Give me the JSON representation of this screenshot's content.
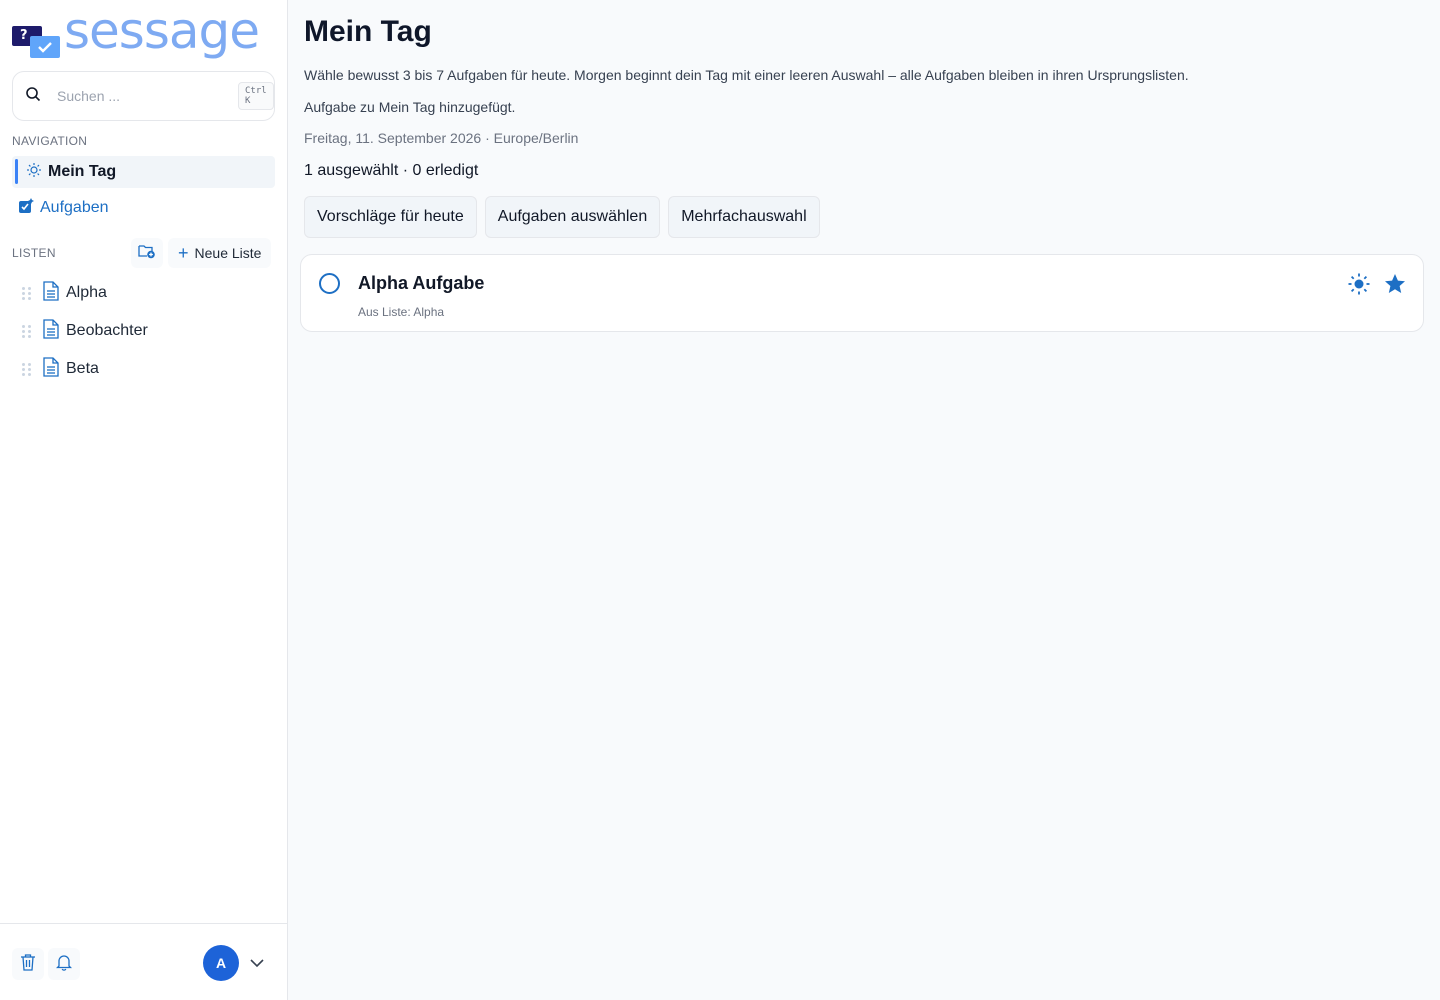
{
  "brand": {
    "name": "sessage",
    "mark_glyph": "?"
  },
  "search": {
    "placeholder": "Suchen ...",
    "shortcut": "Ctrl K"
  },
  "navigation": {
    "heading": "NAVIGATION",
    "items": [
      {
        "label": "Mein Tag",
        "icon": "sun-icon",
        "active": true
      },
      {
        "label": "Aufgaben",
        "icon": "tasks-icon",
        "active": false
      }
    ]
  },
  "lists": {
    "heading": "LISTEN",
    "new_list_label": "Neue Liste",
    "items": [
      {
        "label": "Alpha",
        "icon": "document-icon"
      },
      {
        "label": "Beobachter",
        "icon": "document-icon"
      },
      {
        "label": "Beta",
        "icon": "document-icon"
      }
    ]
  },
  "user": {
    "initial": "A"
  },
  "page": {
    "title": "Mein Tag",
    "description": "Wähle bewusst 3 bis 7 Aufgaben für heute. Morgen beginnt dein Tag mit einer leeren Auswahl – alle Aufgaben bleiben in ihren Ursprungslisten.",
    "notice": "Aufgabe zu Mein Tag hinzugefügt.",
    "date_line": "Freitag, 11. September 2026 · Europe/Berlin",
    "stats": "1 ausgewählt · 0 erledigt",
    "actions": [
      "Vorschläge für heute",
      "Aufgaben auswählen",
      "Mehrfachauswahl"
    ]
  },
  "tasks": [
    {
      "title": "Alpha Aufgabe",
      "meta": "Aus Liste: Alpha",
      "in_my_day": true,
      "starred": true,
      "done": false
    }
  ],
  "colors": {
    "accent": "#1d6fc4",
    "active_bar": "#3b82f6",
    "logo": "#7eaaf2",
    "avatar": "#1d63d8"
  }
}
